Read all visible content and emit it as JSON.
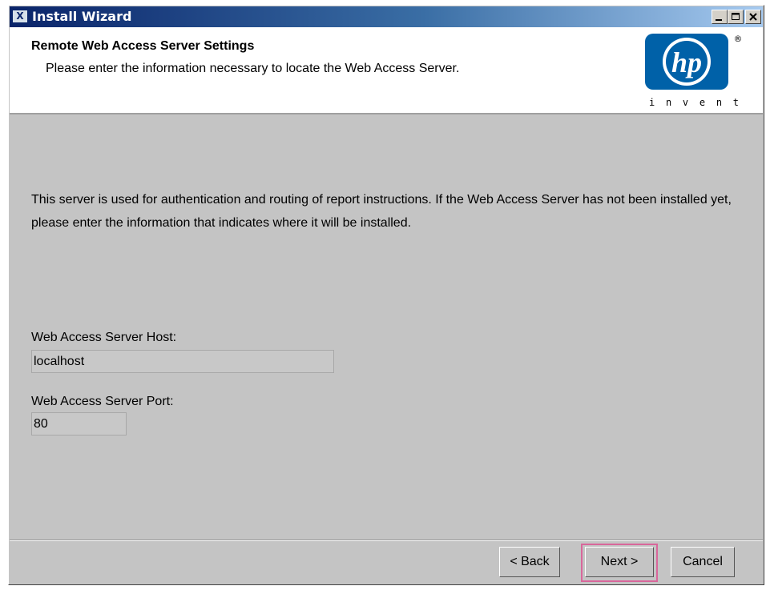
{
  "window": {
    "title": "Install Wizard",
    "title_icon": "java-x-icon",
    "controls": [
      "minimize-icon",
      "maximize-icon",
      "close-icon"
    ]
  },
  "header": {
    "title": "Remote Web Access Server Settings",
    "subtitle": "Please enter the information necessary to locate the Web Access Server.",
    "logo": {
      "brand": "hp",
      "tagline": "invent",
      "registered": "®",
      "brand_color": "#0061a8"
    }
  },
  "body": {
    "description": "This server is used for authentication and routing of report instructions. If the Web Access Server has not been installed yet, please enter the information that indicates where it will be installed."
  },
  "fields": {
    "host": {
      "label": "Web Access Server Host:",
      "value": "localhost"
    },
    "port": {
      "label": "Web Access Server Port:",
      "value": "80"
    }
  },
  "buttons": {
    "back": "< Back",
    "next": "Next >",
    "cancel": "Cancel"
  },
  "colors": {
    "dialog_bg": "#c4c4c4",
    "title_gradient_start": "#0a246a",
    "title_gradient_end": "#a6caf0",
    "focus_highlight": "#d9669b"
  }
}
